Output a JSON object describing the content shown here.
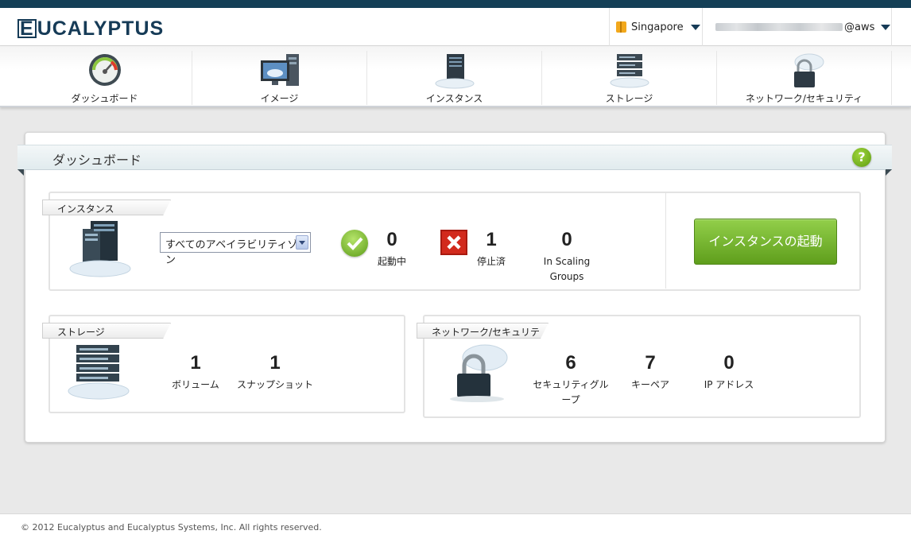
{
  "header": {
    "logo_text": "UCALYPTUS",
    "logo_first": "E",
    "region_label": "Singapore",
    "user_suffix": "@aws"
  },
  "nav": {
    "items": [
      {
        "label": "ダッシュボード",
        "icon": "gauge-icon"
      },
      {
        "label": "イメージ",
        "icon": "monitor-icon"
      },
      {
        "label": "インスタンス",
        "icon": "server-cloud-icon"
      },
      {
        "label": "ストレージ",
        "icon": "storage-rack-icon"
      },
      {
        "label": "ネットワーク/セキュリティ",
        "icon": "cloud-lock-icon"
      }
    ]
  },
  "dashboard": {
    "title": "ダッシュボード",
    "help_label": "?"
  },
  "instances": {
    "tab_label": "インスタンス",
    "zone_select": "すべてのアベイラビリティゾーン",
    "running_count": "0",
    "running_label": "起動中",
    "stopped_count": "1",
    "stopped_label": "停止済",
    "scaling_count": "0",
    "scaling_label_1": "In Scaling",
    "scaling_label_2": "Groups",
    "launch_button": "インスタンスの起動"
  },
  "storage": {
    "tab_label": "ストレージ",
    "volumes_count": "1",
    "volumes_label": "ボリューム",
    "snapshots_count": "1",
    "snapshots_label": "スナップショット"
  },
  "network": {
    "tab_label": "ネットワーク/セキュリティ",
    "security_groups_count": "6",
    "security_groups_label_1": "セキュリティグル",
    "security_groups_label_2": "ープ",
    "keypairs_count": "7",
    "keypairs_label": "キーペア",
    "ip_count": "0",
    "ip_label": "IP アドレス"
  },
  "footer": {
    "copyright": "© 2012 Eucalyptus and Eucalyptus Systems, Inc. All rights reserved."
  },
  "colors": {
    "brand_dark": "#163b57",
    "accent_green": "#6aab22",
    "error_red": "#d22a1d"
  }
}
